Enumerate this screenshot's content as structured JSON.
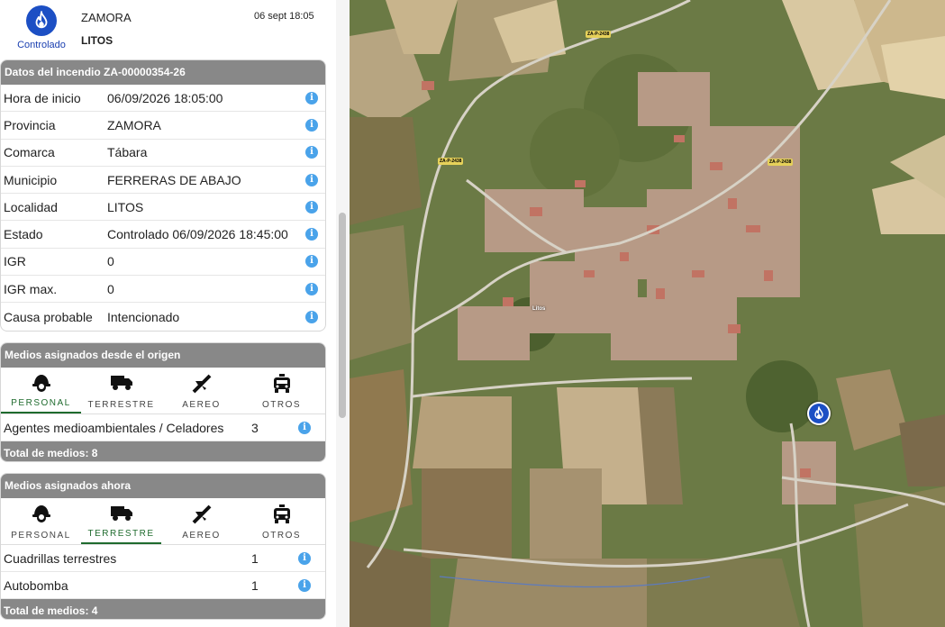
{
  "header": {
    "status": "Controlado",
    "province": "ZAMORA",
    "locality": "LITOS",
    "date": "06 sept 18:05",
    "icon": "fire-drop-icon",
    "color": "#1c4fc4"
  },
  "incident": {
    "title": "Datos del incendio ZA-00000354-26",
    "rows": [
      {
        "label": "Hora de inicio",
        "value": "06/09/2026 18:05:00"
      },
      {
        "label": "Provincia",
        "value": "ZAMORA"
      },
      {
        "label": "Comarca",
        "value": "Tábara"
      },
      {
        "label": "Municipio",
        "value": "FERRERAS DE ABAJO"
      },
      {
        "label": "Localidad",
        "value": "LITOS"
      },
      {
        "label": "Estado",
        "value": "Controlado 06/09/2026 18:45:00"
      },
      {
        "label": "IGR",
        "value": "0"
      },
      {
        "label": "IGR max.",
        "value": "0"
      },
      {
        "label": "Causa probable",
        "value": "Intencionado"
      }
    ]
  },
  "tab_labels": [
    "PERSONAL",
    "TERRESTRE",
    "AEREO",
    "OTROS"
  ],
  "origin": {
    "title": "Medios asignados desde el origen",
    "active_tab": "PERSONAL",
    "rows": [
      {
        "label": "Agentes medioambientales / Celadores",
        "count": "3"
      }
    ],
    "total": "Total de medios: 8"
  },
  "now": {
    "title": "Medios asignados ahora",
    "active_tab": "TERRESTRE",
    "rows": [
      {
        "label": "Cuadrillas terrestres",
        "count": "1"
      },
      {
        "label": "Autobomba",
        "count": "1"
      }
    ],
    "total": "Total de medios: 4"
  },
  "map": {
    "place_label": "Litos",
    "road_shields": [
      "ZA-P-2438",
      "ZA-P-2438",
      "ZA-P-2438"
    ],
    "marker_icon": "fire-drop-icon",
    "accent": "#1f6b2e",
    "header_bg": "#888888"
  }
}
